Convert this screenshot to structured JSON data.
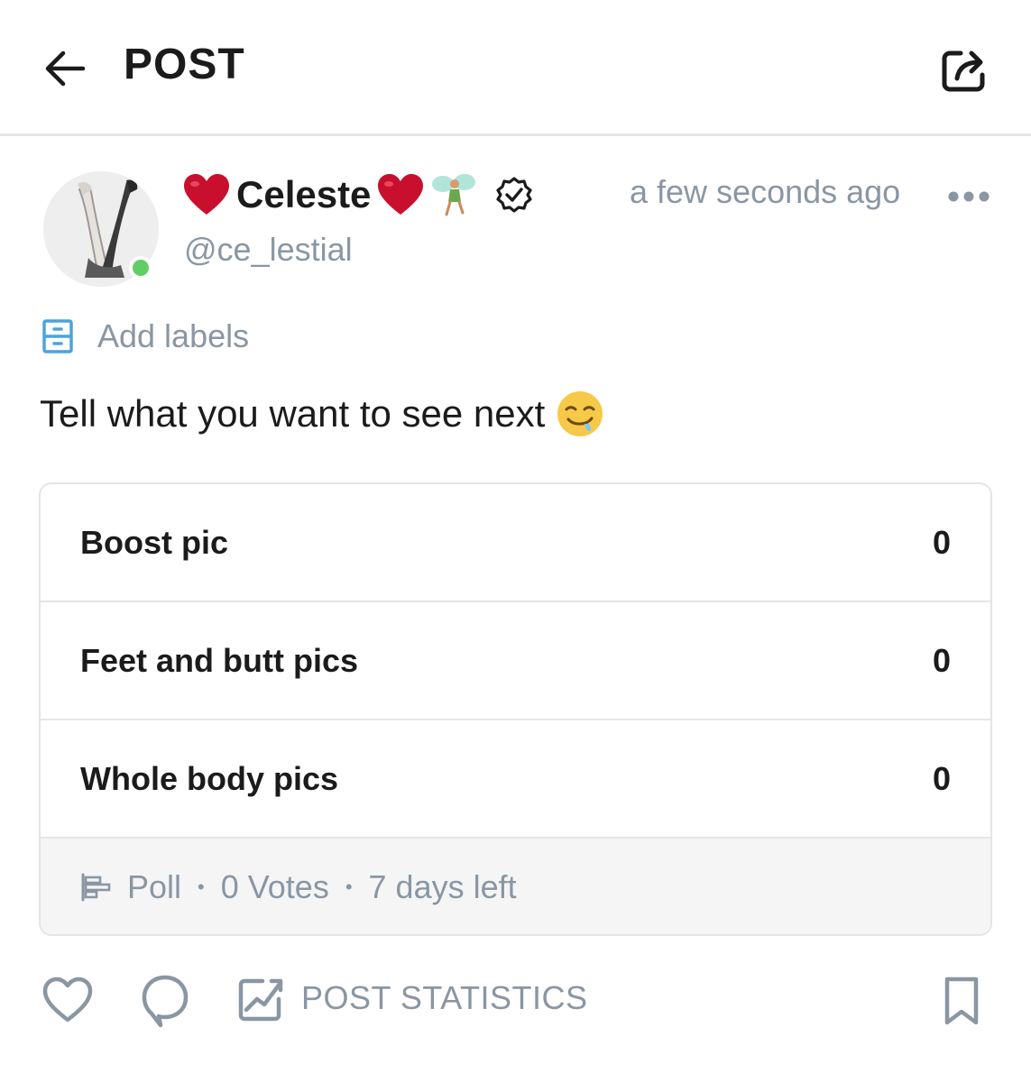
{
  "header": {
    "title": "POST"
  },
  "post": {
    "author_name": "Celeste",
    "author_handle": "@ce_lestial",
    "timestamp": "a few seconds ago",
    "add_labels": "Add labels",
    "text": "Tell what you want to see next"
  },
  "poll": {
    "options": [
      {
        "label": "Boost pic",
        "count": "0"
      },
      {
        "label": "Feet and butt pics",
        "count": "0"
      },
      {
        "label": "Whole body pics",
        "count": "0"
      }
    ],
    "type_label": "Poll",
    "votes": "0 Votes",
    "time_left": "7 days left"
  },
  "actions": {
    "stats_label": "POST STATISTICS"
  },
  "colors": {
    "text_primary": "#1b1b1b",
    "text_muted": "#8a96a3",
    "accent_blue": "#4aa3df",
    "online_green": "#5fcf63",
    "heart_red": "#c8102e"
  }
}
